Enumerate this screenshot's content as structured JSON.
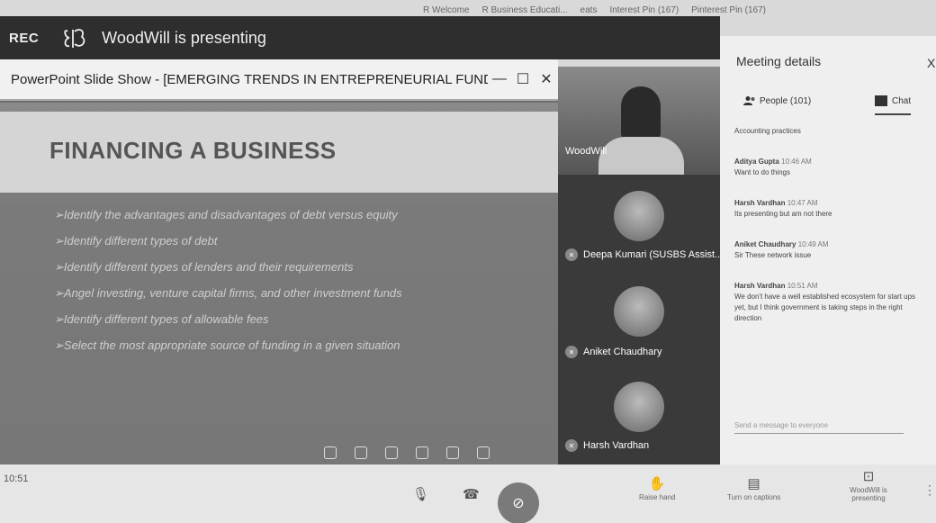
{
  "browser": {
    "bookmarks": [
      "R Welcome",
      "R Business Educati...",
      "eats",
      "Interest Pin (167)",
      "Pinterest Pin (167)"
    ]
  },
  "present_bar": {
    "rec_label": "REC",
    "presenting_text": "WoodWill is presenting"
  },
  "slide_window": {
    "title": "PowerPoint Slide Show - [EMERGING TRENDS IN ENTREPRENEURIAL FUNDING L...",
    "minimize": "—",
    "maximize": "☐",
    "close": "✕",
    "heading": "FINANCING A BUSINESS",
    "bullets": [
      "➢Identify the advantages and disadvantages of debt versus equity",
      "➢Identify different types of debt",
      "➢Identify different types of lenders and their requirements",
      "➢Angel investing, venture capital firms, and other investment funds",
      "➢Identify different types of allowable fees",
      "➢Select the most appropriate source of funding in a given situation"
    ]
  },
  "participants": [
    {
      "name": "WoodWill"
    },
    {
      "name": "Deepa Kumari (SUSBS Assist..."
    },
    {
      "name": "Aniket Chaudhary"
    },
    {
      "name": "Harsh Vardhan"
    }
  ],
  "panel": {
    "title": "Meeting details",
    "close": "X",
    "people_tab": "People (101)",
    "chat_tab": "Chat",
    "messages": [
      {
        "sender": "",
        "time": "",
        "text": "Accounting practices"
      },
      {
        "sender": "Aditya Gupta",
        "time": "10:46 AM",
        "text": "Want to do things"
      },
      {
        "sender": "Harsh Vardhan",
        "time": "10:47 AM",
        "text": "Its presenting but am not there"
      },
      {
        "sender": "Aniket Chaudhary",
        "time": "10:49 AM",
        "text": "Sir These network issue"
      },
      {
        "sender": "Harsh Vardhan",
        "time": "10:51 AM",
        "text": "We don't have a well established ecosystem for start ups yet, but I think government is taking steps in the right direction"
      }
    ],
    "input_placeholder": "Send a message to everyone"
  },
  "bottom_bar": {
    "meeting_time": "10:51",
    "raise_hand": "Raise hand",
    "captions": "Turn on captions",
    "presenting": "WoodWill is presenting"
  }
}
